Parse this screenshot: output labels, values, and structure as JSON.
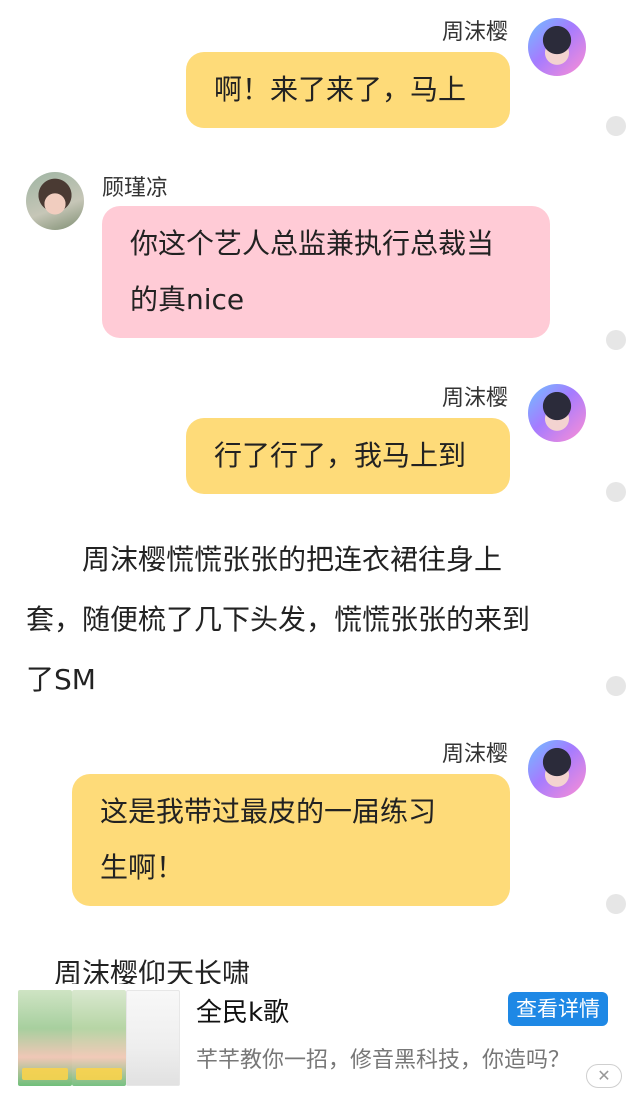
{
  "messages": [
    {
      "name": "周沫樱",
      "text": "啊！来了来了，马上"
    },
    {
      "name": "顾瑾凉",
      "line1": "你这个艺人总监兼执行总裁当",
      "line2": "的真nice"
    },
    {
      "name": "周沫樱",
      "text": "行了行了，我马上到"
    },
    {
      "name": "周沫樱",
      "line1": "这是我带过最皮的一届练习",
      "line2": "生啊！"
    }
  ],
  "narration": {
    "line1": "　　周沫樱慌慌张张的把连衣裙往身上",
    "line2": "套，随便梳了几下头发，慌慌张张的来到",
    "line3": "了SM",
    "partial": "　周沫樱仰天长啸"
  },
  "ad": {
    "title": "全民k歌",
    "description": "芊芊教你一招，修音黑科技，你造吗？",
    "button_label": "查看详情",
    "close_label": "✕"
  }
}
